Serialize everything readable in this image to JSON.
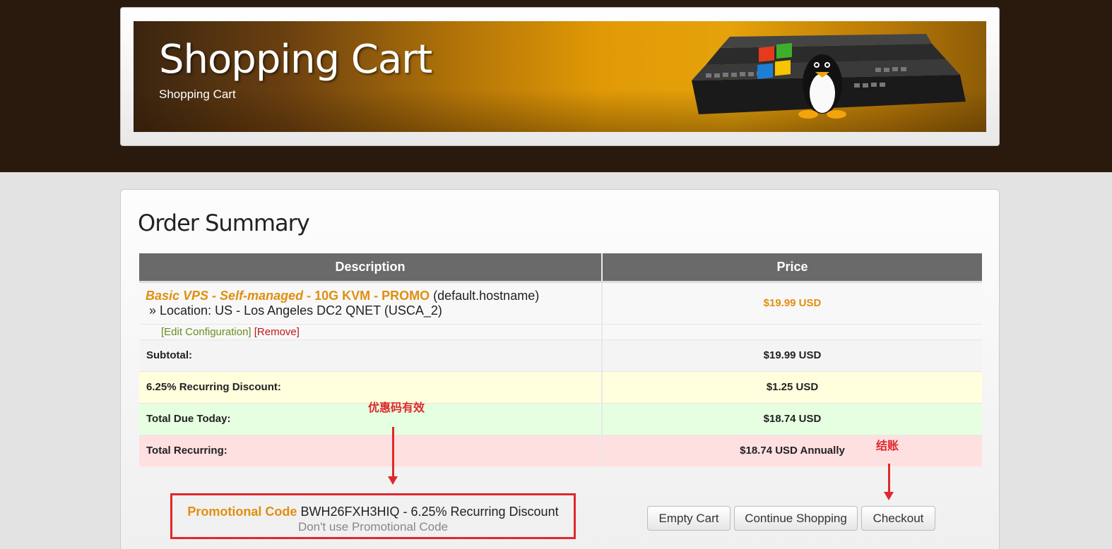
{
  "header": {
    "title": "Shopping Cart",
    "subtitle": "Shopping Cart"
  },
  "order": {
    "title": "Order Summary",
    "columns": {
      "description": "Description",
      "price": "Price"
    },
    "item": {
      "product_name": "Basic VPS - Self-managed",
      "separator": " - ",
      "plan": "10G KVM - PROMO",
      "hostname": "(default.hostname)",
      "location": "» Location: US - Los Angeles DC2 QNET (USCA_2)",
      "price": "$19.99 USD",
      "edit_label": "[Edit Configuration]",
      "remove_label": "[Remove]"
    },
    "summary": {
      "subtotal_label": "Subtotal:",
      "subtotal_value": "$19.99 USD",
      "discount_label": "6.25% Recurring Discount:",
      "discount_value": "$1.25 USD",
      "due_label": "Total Due Today:",
      "due_value": "$18.74 USD",
      "recurring_label": "Total Recurring:",
      "recurring_value": "$18.74 USD Annually"
    }
  },
  "promo": {
    "label": "Promotional Code",
    "text": "BWH26FXH3HIQ - 6.25% Recurring Discount",
    "remove_link": "Don't use Promotional Code"
  },
  "buttons": {
    "empty_cart": "Empty Cart",
    "continue_shopping": "Continue Shopping",
    "checkout": "Checkout"
  },
  "annotations": {
    "promo_valid": "优惠码有效",
    "checkout": "结账"
  },
  "colors": {
    "accent_orange": "#e08f10",
    "annotation_red": "#e0282c",
    "header_dark": "#2a1a0e"
  }
}
